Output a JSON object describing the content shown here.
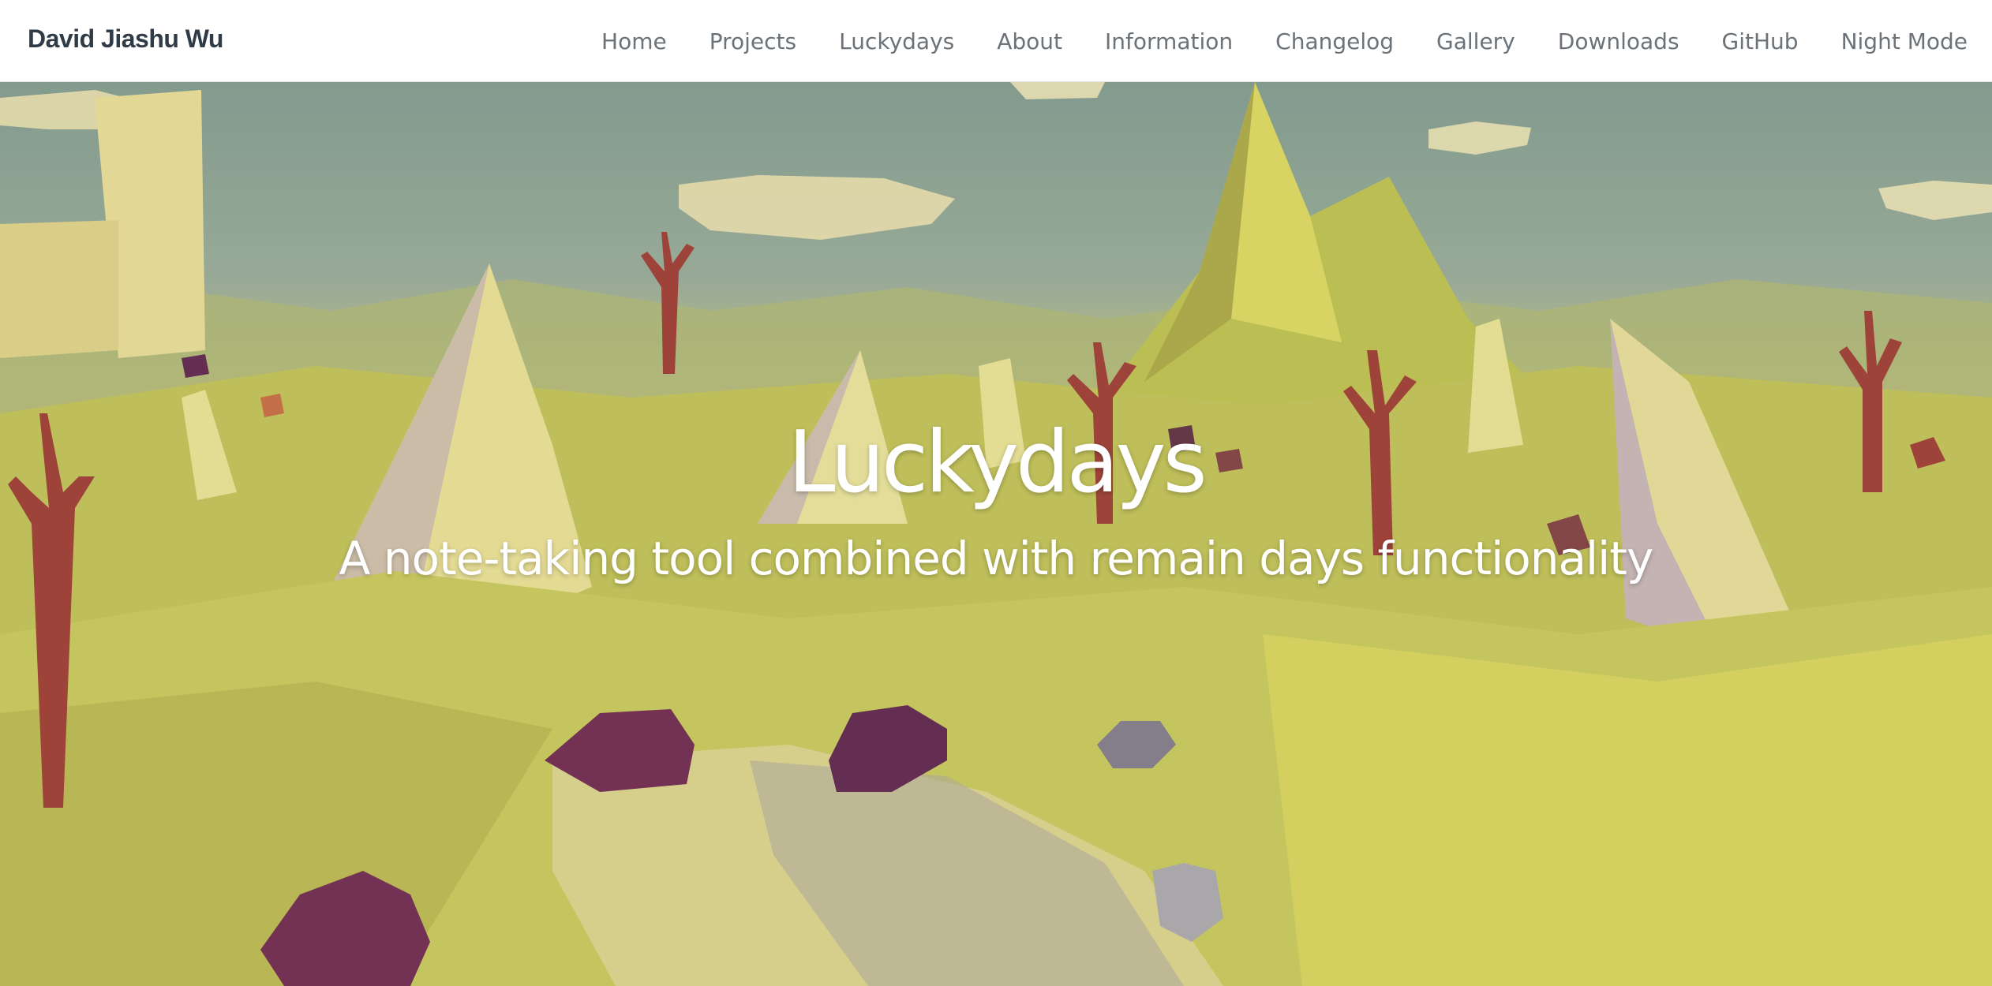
{
  "navbar": {
    "brand": "David Jiashu Wu",
    "links": [
      {
        "label": "Home"
      },
      {
        "label": "Projects"
      },
      {
        "label": "Luckydays"
      },
      {
        "label": "About"
      },
      {
        "label": "Information"
      },
      {
        "label": "Changelog"
      },
      {
        "label": "Gallery"
      },
      {
        "label": "Downloads"
      },
      {
        "label": "GitHub"
      },
      {
        "label": "Night Mode"
      }
    ]
  },
  "hero": {
    "title": "Luckydays",
    "subtitle": "A note-taking tool combined with remain days functionality",
    "background_image": "low-poly-landscape",
    "colors": {
      "sky": "#8aa598",
      "ground": "#d4d56a",
      "rock": "#f2e9a6",
      "tree": "#a8463c",
      "boulder": "#7a3358"
    }
  }
}
